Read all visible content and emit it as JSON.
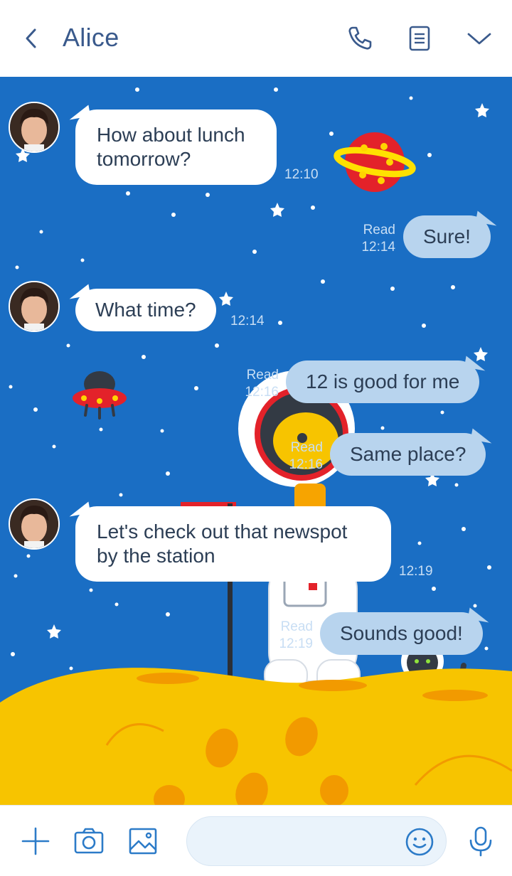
{
  "header": {
    "title": "Alice",
    "icons": [
      "back-chevron-icon",
      "phone-icon",
      "notes-icon",
      "chevron-down-icon"
    ]
  },
  "theme": {
    "header_text": "#3a5a8c",
    "sky": "#1a6ec4",
    "moon": "#f7c400",
    "bubble_out": "#b8d4ee",
    "bubble_in": "#ffffff",
    "meta_text": "#c8def4"
  },
  "messages": [
    {
      "direction": "in",
      "text": "How about lunch tomorrow?",
      "time": "12:10"
    },
    {
      "direction": "out",
      "text": "Sure!",
      "status": "Read",
      "time": "12:14"
    },
    {
      "direction": "in",
      "text": "What time?",
      "time": "12:14"
    },
    {
      "direction": "out",
      "text": "12 is good for me",
      "status": "Read",
      "time": "12:16"
    },
    {
      "direction": "out",
      "text": "Same place?",
      "status": "Read",
      "time": "12:16"
    },
    {
      "direction": "in",
      "text": "Let's check out that newspot by the station",
      "time": "12:19"
    },
    {
      "direction": "out",
      "text": "Sounds good!",
      "status": "Read",
      "time": "12:19"
    }
  ],
  "input": {
    "placeholder": "",
    "icons": [
      "plus-icon",
      "camera-icon",
      "image-icon",
      "smiley-icon",
      "microphone-icon"
    ]
  }
}
